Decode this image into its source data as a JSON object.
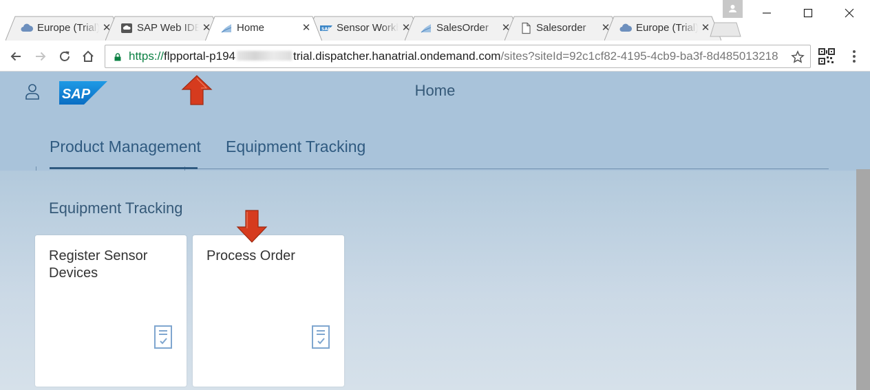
{
  "browser": {
    "tabs": [
      {
        "title": "Europe (Trial)",
        "favicon": "cloud-icon",
        "active": false
      },
      {
        "title": "SAP Web IDE",
        "favicon": "web-ide-icon",
        "active": false
      },
      {
        "title": "Home",
        "favicon": "sap-page-icon",
        "active": true
      },
      {
        "title": "Sensor Workbench",
        "favicon": "sap-logo-icon",
        "active": false
      },
      {
        "title": "SalesOrder",
        "favicon": "sap-page-icon",
        "active": false
      },
      {
        "title": "Salesorder",
        "favicon": "document-icon",
        "active": false
      },
      {
        "title": "Europe (Trial)",
        "favicon": "cloud-icon",
        "active": false
      }
    ],
    "close_glyph": "✕",
    "url": {
      "scheme": "https://",
      "host_start": "flpportal-p194",
      "host_end": "trial.dispatcher.hanatrial.ondemand.com",
      "path": "/sites?siteId=92c1cf82-4195-4cb9-ba3f-8d485013218"
    }
  },
  "shell": {
    "title": "Home",
    "logo_text": "SAP"
  },
  "anchors": [
    {
      "label": "Product Management",
      "selected": true
    },
    {
      "label": "Equipment Tracking",
      "selected": false
    }
  ],
  "group": {
    "title": "Equipment Tracking",
    "tiles": [
      {
        "title": "Register Sensor Devices",
        "icon": "task-list-icon"
      },
      {
        "title": "Process Order",
        "icon": "task-list-icon"
      }
    ]
  },
  "colors": {
    "shell_bg": "#a9c3da",
    "text_blue": "#2f5a80",
    "arrow_red": "#d63b1e"
  }
}
